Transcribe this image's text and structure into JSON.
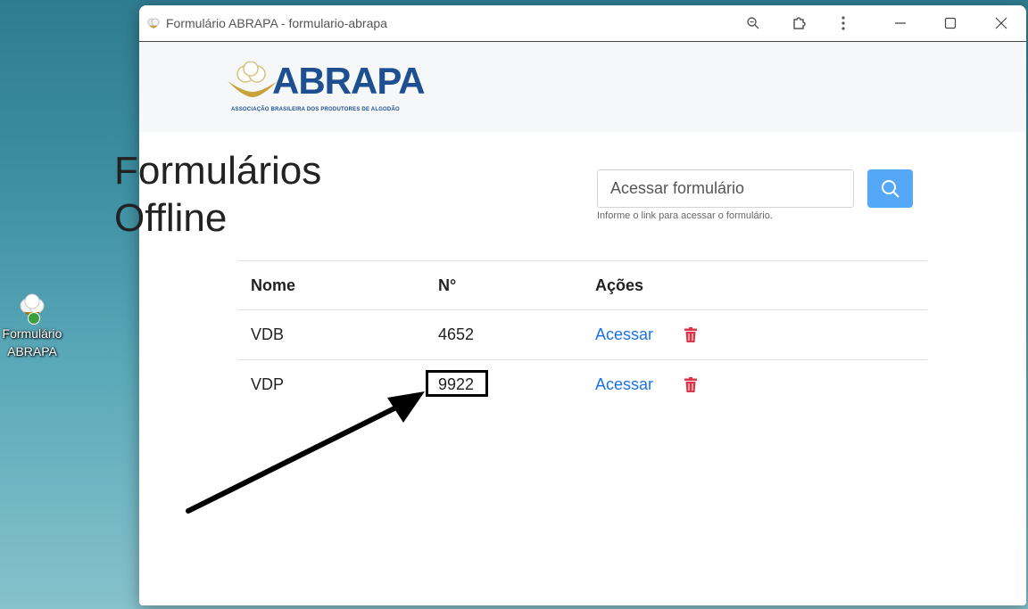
{
  "desktop": {
    "icon_label_line1": "Formulário",
    "icon_label_line2": "ABRAPA"
  },
  "window": {
    "title": "Formulário ABRAPA - formulario-abrapa",
    "logo_word": "ABRAPA",
    "logo_sub": "ASSOCIAÇÃO BRASILEIRA DOS PRODUTORES DE ALGODÃO"
  },
  "page": {
    "title_line1": "Formulários",
    "title_line2": "Offline",
    "search_placeholder": "Acessar formulário",
    "search_help": "Informe o link para acessar o formulário."
  },
  "table": {
    "headers": [
      "Nome",
      "N°",
      "Ações"
    ],
    "rows": [
      {
        "name": "VDB",
        "number": "4652",
        "action": "Acessar"
      },
      {
        "name": "VDP",
        "number": "9922",
        "action": "Acessar"
      }
    ]
  },
  "colors": {
    "brand": "#1d4f91",
    "accent": "#55a8f7",
    "link": "#1a73e8",
    "danger": "#dc3545"
  }
}
